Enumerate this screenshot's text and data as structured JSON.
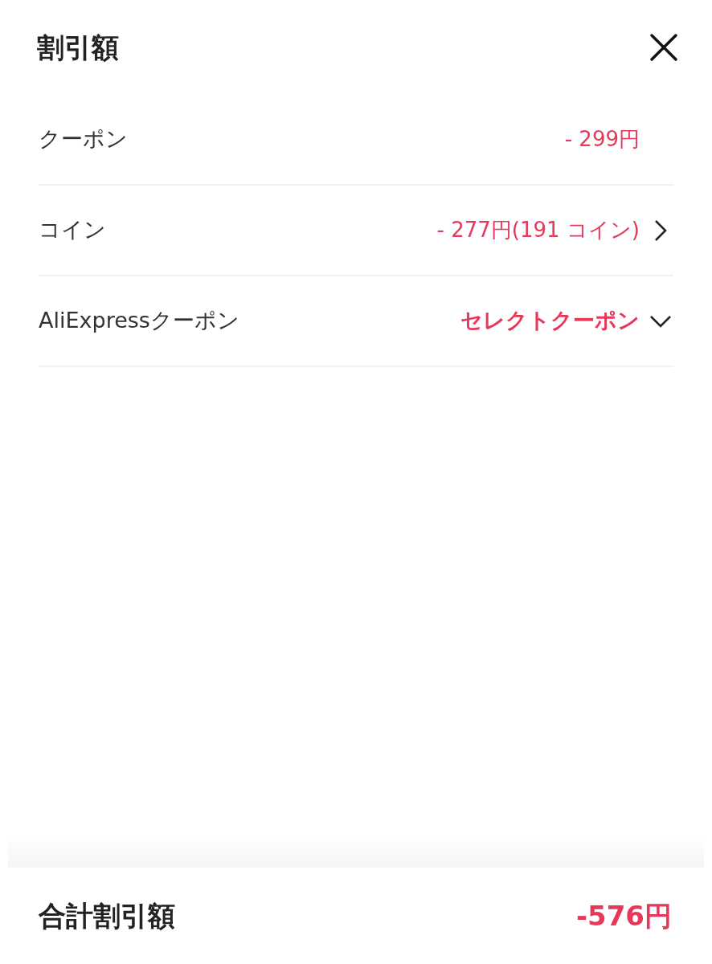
{
  "header": {
    "title": "割引額"
  },
  "rows": [
    {
      "kind": "plain",
      "label": "クーポン",
      "value": "- 299円"
    },
    {
      "kind": "link",
      "label": "コイン",
      "value": "- 277円(191 コイン)"
    },
    {
      "kind": "dropdown",
      "label": "AliExpressクーポン",
      "value": "セレクトクーポン"
    }
  ],
  "footer": {
    "label": "合計割引額",
    "total": "-576円"
  }
}
